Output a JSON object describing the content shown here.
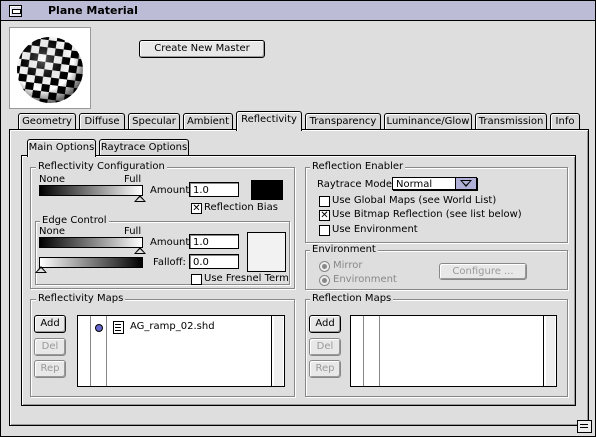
{
  "window": {
    "title": "Plane Material"
  },
  "header": {
    "create_master_label": "Create New Master"
  },
  "tabs": [
    "Geometry",
    "Diffuse",
    "Specular",
    "Ambient",
    "Reflectivity",
    "Transparency",
    "Luminance/Glow",
    "Transmission",
    "Info"
  ],
  "active_tab": "Reflectivity",
  "subtabs": [
    "Main Options",
    "Raytrace Options"
  ],
  "active_subtab": "Main Options",
  "reflectivity_config": {
    "label": "Reflectivity Configuration",
    "none_label": "None",
    "full_label": "Full",
    "amount_label": "Amount:",
    "amount_value": "1.0",
    "slider_level": 1.0,
    "swatch_color": "#000000",
    "reflection_bias_label": "Reflection Bias",
    "reflection_bias_checked": true
  },
  "edge_control": {
    "label": "Edge Control",
    "none_label": "None",
    "full_label": "Full",
    "amount_label": "Amount:",
    "amount_value": "1.0",
    "falloff_label": "Falloff:",
    "falloff_value": "0.0",
    "amount_slider_level": 1.0,
    "falloff_slider_level": 0.0,
    "swatch_color": "#f2f2f2",
    "fresnel_label": "Use Fresnel Term",
    "fresnel_checked": false
  },
  "reflection_enabler": {
    "label": "Reflection Enabler",
    "raytrace_mode_label": "Raytrace Mode:",
    "raytrace_mode_value": "Normal",
    "global_maps_label": "Use Global Maps (see World List)",
    "global_maps_checked": false,
    "bitmap_reflection_label": "Use Bitmap Reflection (see list below)",
    "bitmap_reflection_checked": true,
    "use_environment_label": "Use Environment",
    "use_environment_checked": false
  },
  "environment": {
    "label": "Environment",
    "mirror_label": "Mirror",
    "environment_label": "Environment",
    "selected": "Mirror",
    "configure_label": "Configure ..."
  },
  "reflectivity_maps": {
    "label": "Reflectivity Maps",
    "add_label": "Add",
    "del_label": "Del",
    "rep_label": "Rep",
    "items": [
      {
        "name": "AG_ramp_02.shd",
        "icon": "shader-file-icon"
      }
    ]
  },
  "reflection_maps": {
    "label": "Reflection Maps",
    "add_label": "Add",
    "del_label": "Del",
    "rep_label": "Rep",
    "items": []
  },
  "colors": {
    "titlebar": "#bcbcd6",
    "background": "#dedede",
    "select_accent": "#b0b0d8",
    "list_marker": "#6666cc"
  }
}
